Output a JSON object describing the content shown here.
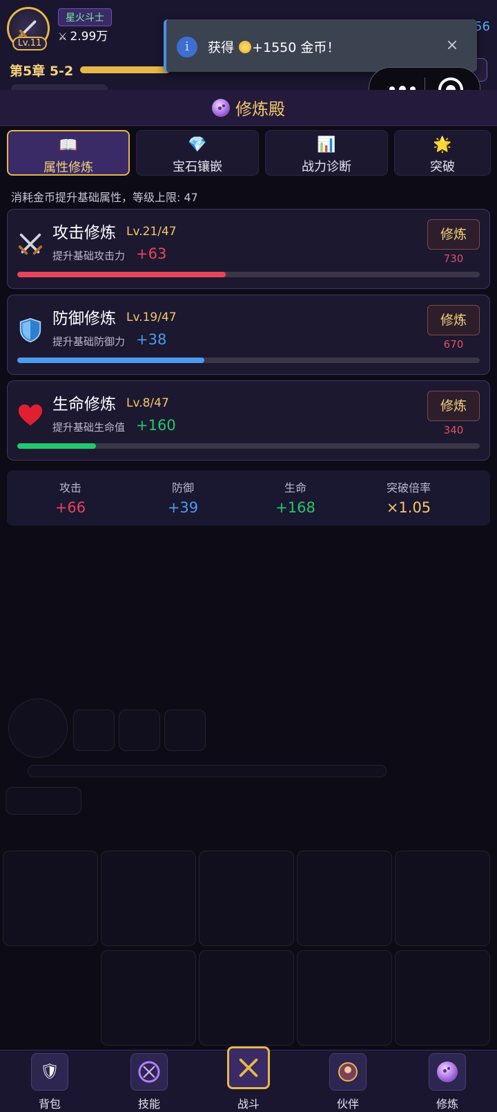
{
  "hud": {
    "player_name": "星火斗士",
    "level_label": "Lv.11",
    "power": "2.99万",
    "right_number": "56",
    "chapter": "第5章 5-2"
  },
  "toast": {
    "text_prefix": "获得",
    "text_suffix": "+1550 金币！",
    "close_glyph": "×",
    "info_glyph": "i"
  },
  "panel": {
    "title": "修炼殿"
  },
  "tabs": [
    {
      "label": "属性修炼",
      "icon": "book-icon",
      "active": true
    },
    {
      "label": "宝石镶嵌",
      "icon": "diamond-icon",
      "active": false
    },
    {
      "label": "战力诊断",
      "icon": "bar-chart-icon",
      "active": false
    },
    {
      "label": "突破",
      "icon": "burst-icon",
      "active": false
    }
  ],
  "description": "消耗金币提升基础属性，等级上限: 47",
  "cards": [
    {
      "name": "攻击修炼",
      "level": "Lv.21/47",
      "sub": "提升基础攻击力",
      "value": "+63",
      "button": "修炼",
      "cost": "730",
      "progress": 0.45,
      "color": "#e8455a",
      "icon": "crossed-swords-icon"
    },
    {
      "name": "防御修炼",
      "level": "Lv.19/47",
      "sub": "提升基础防御力",
      "value": "+38",
      "button": "修炼",
      "cost": "670",
      "progress": 0.405,
      "color": "#4a9cf0",
      "icon": "shield-icon"
    },
    {
      "name": "生命修炼",
      "level": "Lv.8/47",
      "sub": "提升基础生命值",
      "value": "+160",
      "button": "修炼",
      "cost": "340",
      "progress": 0.17,
      "color": "#22c86e",
      "icon": "heart-icon"
    }
  ],
  "summary": [
    {
      "label": "攻击",
      "value": "+66",
      "color": "#e8455a"
    },
    {
      "label": "防御",
      "value": "+39",
      "color": "#4a9cf0"
    },
    {
      "label": "生命",
      "value": "+168",
      "color": "#22c86e"
    },
    {
      "label": "突破倍率",
      "value": "×1.05",
      "color": "#f3c86a"
    }
  ],
  "nav": [
    {
      "label": "背包",
      "icon": "shield-bag-icon",
      "active": false
    },
    {
      "label": "技能",
      "icon": "magic-circle-icon",
      "active": false
    },
    {
      "label": "战斗",
      "icon": "battle-swords-icon",
      "active": true
    },
    {
      "label": "伙伴",
      "icon": "partner-icon",
      "active": false
    },
    {
      "label": "修炼",
      "icon": "crystal-ball-icon",
      "active": false
    }
  ],
  "colors": {
    "accent_gold": "#e6b84a",
    "attack": "#e8455a",
    "defense": "#4a9cf0",
    "life": "#22c86e"
  }
}
